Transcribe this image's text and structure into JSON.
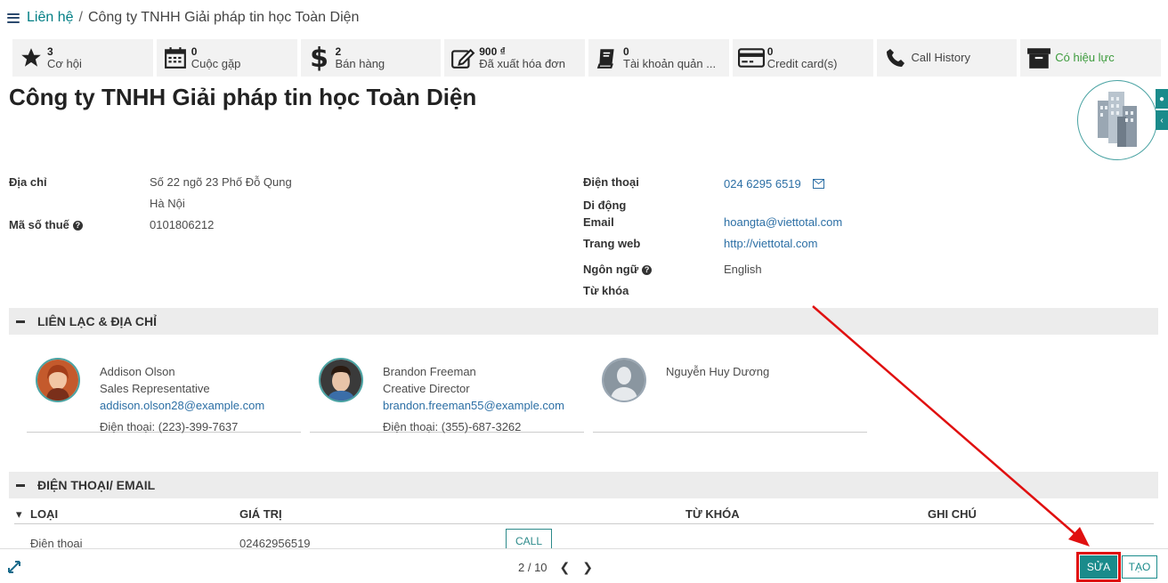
{
  "breadcrumb": {
    "parent": "Liên hệ",
    "separator": "/",
    "current": "Công ty TNHH Giải pháp tin học Toàn Diện"
  },
  "stats": [
    {
      "icon": "star-icon",
      "number": "3",
      "label": "Cơ hội"
    },
    {
      "icon": "calendar-icon",
      "number": "0",
      "label": "Cuộc gặp"
    },
    {
      "icon": "dollar-icon",
      "number": "2",
      "label": "Bán hàng"
    },
    {
      "icon": "edit-invoice-icon",
      "number": "900 ₫",
      "label": "Đã xuất hóa đơn"
    },
    {
      "icon": "book-icon",
      "number": "0",
      "label": "Tài khoản quản ..."
    },
    {
      "icon": "credit-card-icon",
      "number": "0",
      "label": "Credit card(s)"
    },
    {
      "icon": "phone-icon",
      "label": "Call History"
    },
    {
      "icon": "archive-icon",
      "label": "Có hiệu lực"
    }
  ],
  "record_title": "Công ty TNHH Giải pháp tin học Toàn Diện",
  "fields_left": {
    "address_label": "Địa chỉ",
    "address_line1": "Số 22 ngõ 23 Phố Đỗ Qung",
    "address_line2": "Hà Nội",
    "tax_label": "Mã số thuế",
    "tax_value": "0101806212"
  },
  "fields_right": {
    "phone_label": "Điện thoại",
    "phone_value": "024 6295 6519",
    "mobile_label": "Di động",
    "email_label": "Email",
    "email_value": "hoangta@viettotal.com",
    "web_label": "Trang web",
    "web_value": "http://viettotal.com",
    "lang_label": "Ngôn ngữ",
    "lang_value": "English",
    "tags_label": "Từ khóa"
  },
  "section_contacts": "LIÊN LẠC & ĐỊA CHỈ",
  "contacts": [
    {
      "name": "Addison Olson",
      "role": "Sales Representative",
      "email": "addison.olson28@example.com",
      "phone": "Điện thoại: (223)-399-7637"
    },
    {
      "name": "Brandon Freeman",
      "role": "Creative Director",
      "email": "brandon.freeman55@example.com",
      "phone": "Điện thoại: (355)-687-3262"
    },
    {
      "name": "Nguyễn Huy Dương",
      "role": "",
      "email": "",
      "phone": ""
    }
  ],
  "section_phone": "ĐIỆN THOẠI/ EMAIL",
  "phone_table": {
    "headers": [
      "LOẠI",
      "GIÁ TRỊ",
      "TỪ KHÓA",
      "GHI CHÚ"
    ],
    "rows": [
      {
        "type": "Điện thoại",
        "value": "02462956519",
        "action": "CALL"
      }
    ]
  },
  "pager": {
    "text": "2 / 10"
  },
  "buttons": {
    "edit": "SỬA",
    "create": "TẠO"
  },
  "colors": {
    "accent": "#1a8b8b",
    "link": "#2c6fa5",
    "annotation": "#e01010"
  }
}
